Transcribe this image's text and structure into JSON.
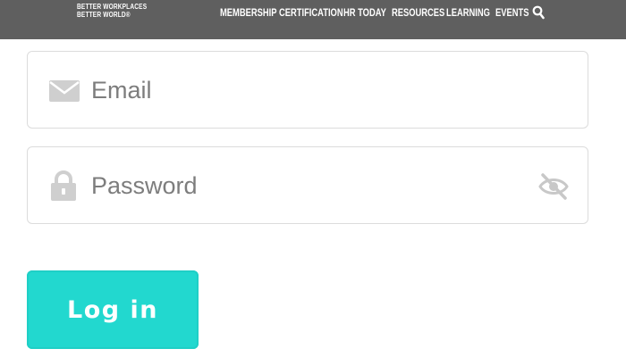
{
  "header": {
    "brand_line1": "BETTER WORKPLACES",
    "brand_line2": "BETTER WORLD®",
    "nav": [
      "MEMBERSHIP",
      "CERTIFICATION",
      "HR TODAY",
      "RESOURCES",
      "LEARNING",
      "EVENTS"
    ],
    "bg_color": "#5f5f5f",
    "search_icon": "search-icon"
  },
  "form": {
    "email_placeholder": "Email",
    "email_icon": "envelope-icon",
    "password_placeholder": "Password",
    "password_icon": "lock-icon",
    "visibility_icon": "eye-slash-icon",
    "login_label": "Log in",
    "accent_color": "#22d8cf"
  }
}
